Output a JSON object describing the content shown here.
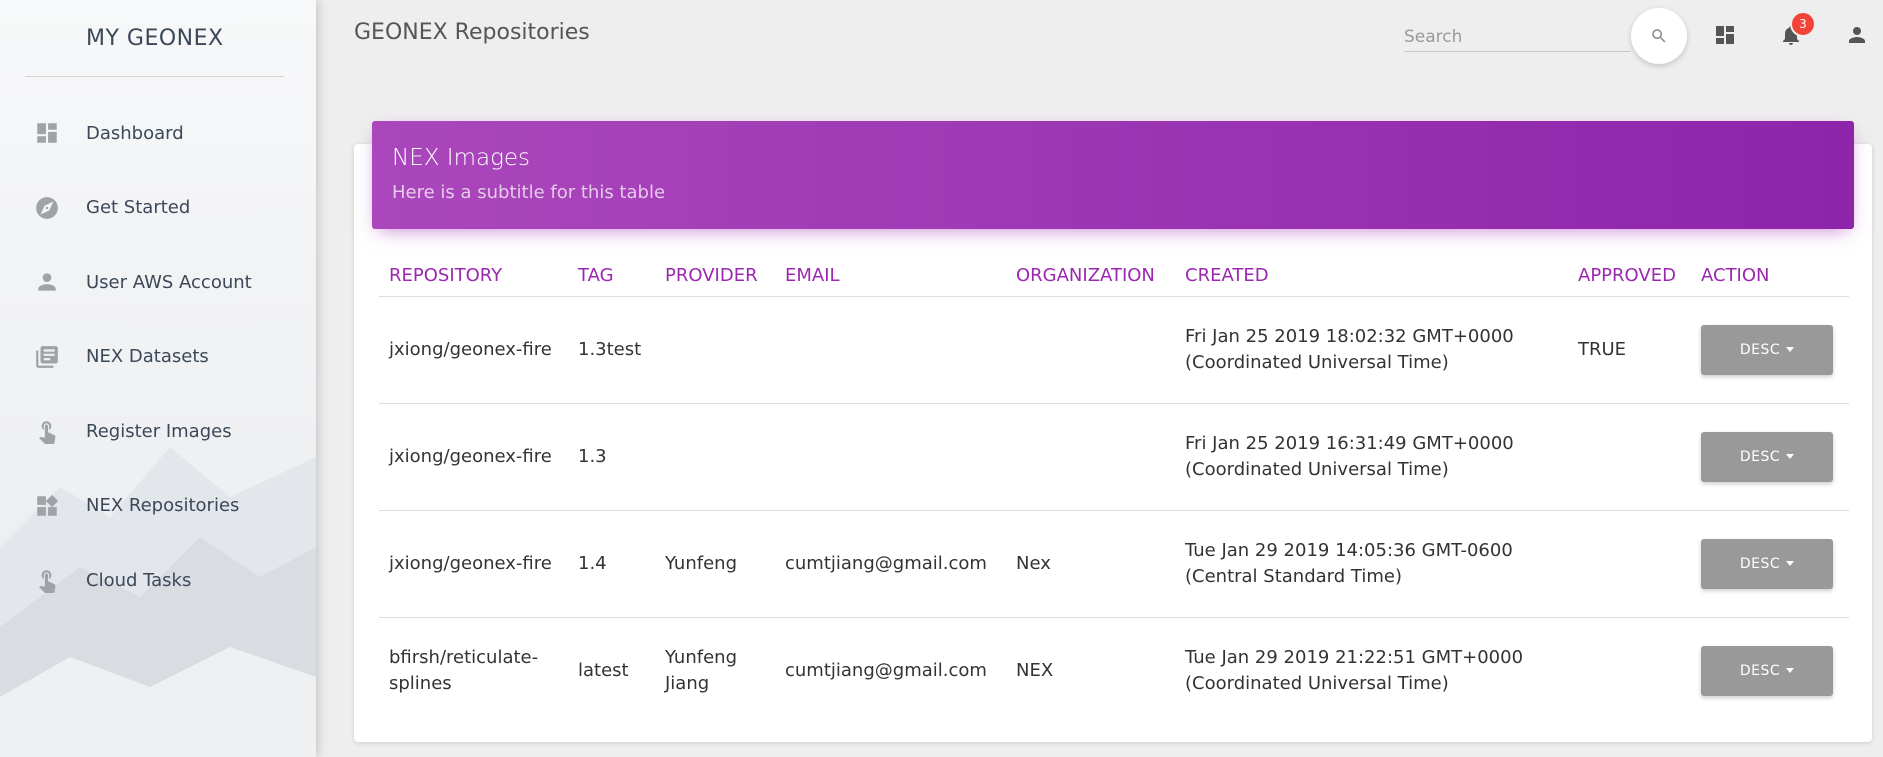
{
  "sidebar": {
    "brand": "MY GEONEX",
    "items": [
      {
        "label": "Dashboard",
        "icon": "dashboard-icon"
      },
      {
        "label": "Get Started",
        "icon": "compass-icon"
      },
      {
        "label": "User AWS Account",
        "icon": "person-icon"
      },
      {
        "label": "NEX Datasets",
        "icon": "library-books-icon"
      },
      {
        "label": "Register Images",
        "icon": "touch-icon"
      },
      {
        "label": "NEX Repositories",
        "icon": "widgets-icon"
      },
      {
        "label": "Cloud Tasks",
        "icon": "touch-icon"
      }
    ]
  },
  "header": {
    "title": "GEONEX Repositories",
    "search_placeholder": "Search",
    "notifications_count": "3"
  },
  "card": {
    "title": "NEX Images",
    "subtitle": "Here is a subtitle for this table",
    "columns": [
      "REPOSITORY",
      "TAG",
      "PROVIDER",
      "EMAIL",
      "ORGANIZATION",
      "CREATED",
      "APPROVED",
      "ACTION"
    ],
    "rows": [
      {
        "repository": "jxiong/geonex-fire",
        "tag": "1.3test",
        "provider": "",
        "email": "",
        "organization": "",
        "created": "Fri Jan 25 2019 18:02:32 GMT+0000 (Coordinated Universal Time)",
        "approved": "TRUE",
        "action": "DESC"
      },
      {
        "repository": "jxiong/geonex-fire",
        "tag": "1.3",
        "provider": "",
        "email": "",
        "organization": "",
        "created": "Fri Jan 25 2019 16:31:49 GMT+0000 (Coordinated Universal Time)",
        "approved": "",
        "action": "DESC"
      },
      {
        "repository": "jxiong/geonex-fire",
        "tag": "1.4",
        "provider": "Yunfeng",
        "email": "cumtjiang@gmail.com",
        "organization": "Nex",
        "created": "Tue Jan 29 2019 14:05:36 GMT-0600 (Central Standard Time)",
        "approved": "",
        "action": "DESC"
      },
      {
        "repository": "bfirsh/reticulate-splines",
        "tag": "latest",
        "provider": "Yunfeng Jiang",
        "email": "cumtjiang@gmail.com",
        "organization": "NEX",
        "created": "Tue Jan 29 2019 21:22:51 GMT+0000 (Coordinated Universal Time)",
        "approved": "",
        "action": "DESC"
      }
    ]
  },
  "colors": {
    "accent": "#9c27b0",
    "header_gradient_start": "#ab47bc",
    "header_gradient_end": "#8e24aa",
    "button_gray": "#999999",
    "badge_red": "#f44336"
  }
}
